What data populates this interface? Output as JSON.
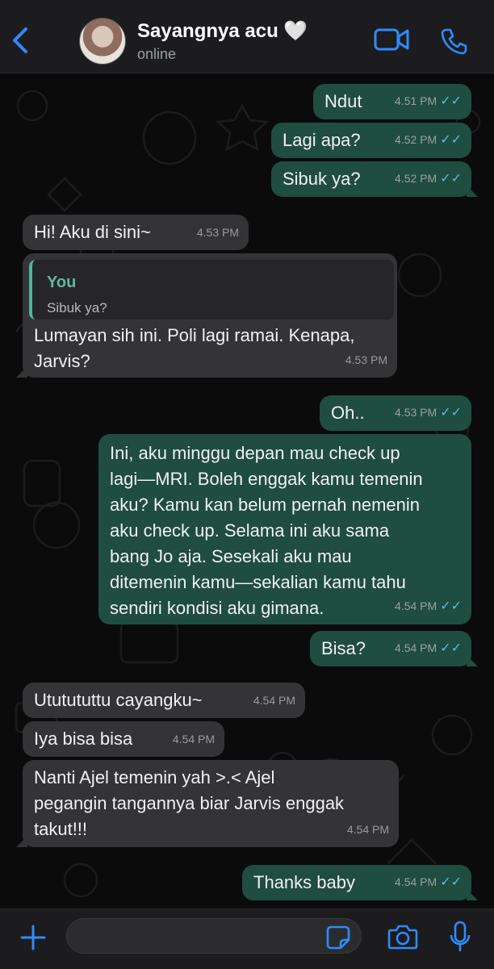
{
  "header": {
    "contact_name": "Sayangnya acu 🤍",
    "status": "online"
  },
  "colors": {
    "accent": "#2f8bff",
    "outgoing_bubble": "#1f4d3f",
    "incoming_bubble": "#343436",
    "read_ticks": "#53bdeb"
  },
  "messages": [
    {
      "dir": "out",
      "text": "Ndut",
      "time": "4.51 PM",
      "ticks": "✓✓"
    },
    {
      "dir": "out",
      "text": "Lagi apa?",
      "time": "4.52 PM",
      "ticks": "✓✓"
    },
    {
      "dir": "out",
      "text": "Sibuk ya?",
      "time": "4.52 PM",
      "ticks": "✓✓"
    },
    {
      "dir": "in",
      "text": "Hi! Aku di sini~",
      "time": "4.53 PM"
    },
    {
      "dir": "in",
      "quote_author": "You",
      "quote_text": "Sibuk ya?",
      "lines": [
        "Lumayan sih ini. Poli lagi ramai. Kenapa,",
        "Jarvis?"
      ],
      "time": "4.53 PM"
    },
    {
      "dir": "out",
      "text": "Oh..",
      "time": "4.53 PM",
      "ticks": "✓✓"
    },
    {
      "dir": "out",
      "lines": [
        "Ini, aku minggu depan mau check up",
        "lagi—MRI. Boleh enggak kamu temenin",
        "aku? Kamu kan belum pernah nemenin",
        "aku check up. Selama ini aku sama",
        "bang Jo aja. Sesekali aku mau",
        "ditemenin kamu—sekalian kamu tahu",
        "sendiri kondisi aku gimana."
      ],
      "time": "4.54 PM",
      "ticks": "✓✓"
    },
    {
      "dir": "out",
      "text": "Bisa?",
      "time": "4.54 PM",
      "ticks": "✓✓"
    },
    {
      "dir": "in",
      "text": "Ututututtu cayangku~",
      "time": "4.54 PM"
    },
    {
      "dir": "in",
      "text": "Iya bisa bisa",
      "time": "4.54 PM"
    },
    {
      "dir": "in",
      "lines": [
        "Nanti Ajel temenin yah >.< Ajel",
        "pegangin tangannya biar Jarvis enggak",
        "takut!!!"
      ],
      "time": "4.54 PM"
    },
    {
      "dir": "out",
      "text": "Thanks baby",
      "time": "4.54 PM",
      "ticks": "✓✓"
    }
  ],
  "composer": {
    "value": ""
  },
  "icons": {
    "back": "chevron-left-icon",
    "video": "video-camera-icon",
    "call": "phone-icon",
    "attach": "plus-icon",
    "sticker": "sticker-icon",
    "camera": "camera-icon",
    "mic": "microphone-icon"
  }
}
